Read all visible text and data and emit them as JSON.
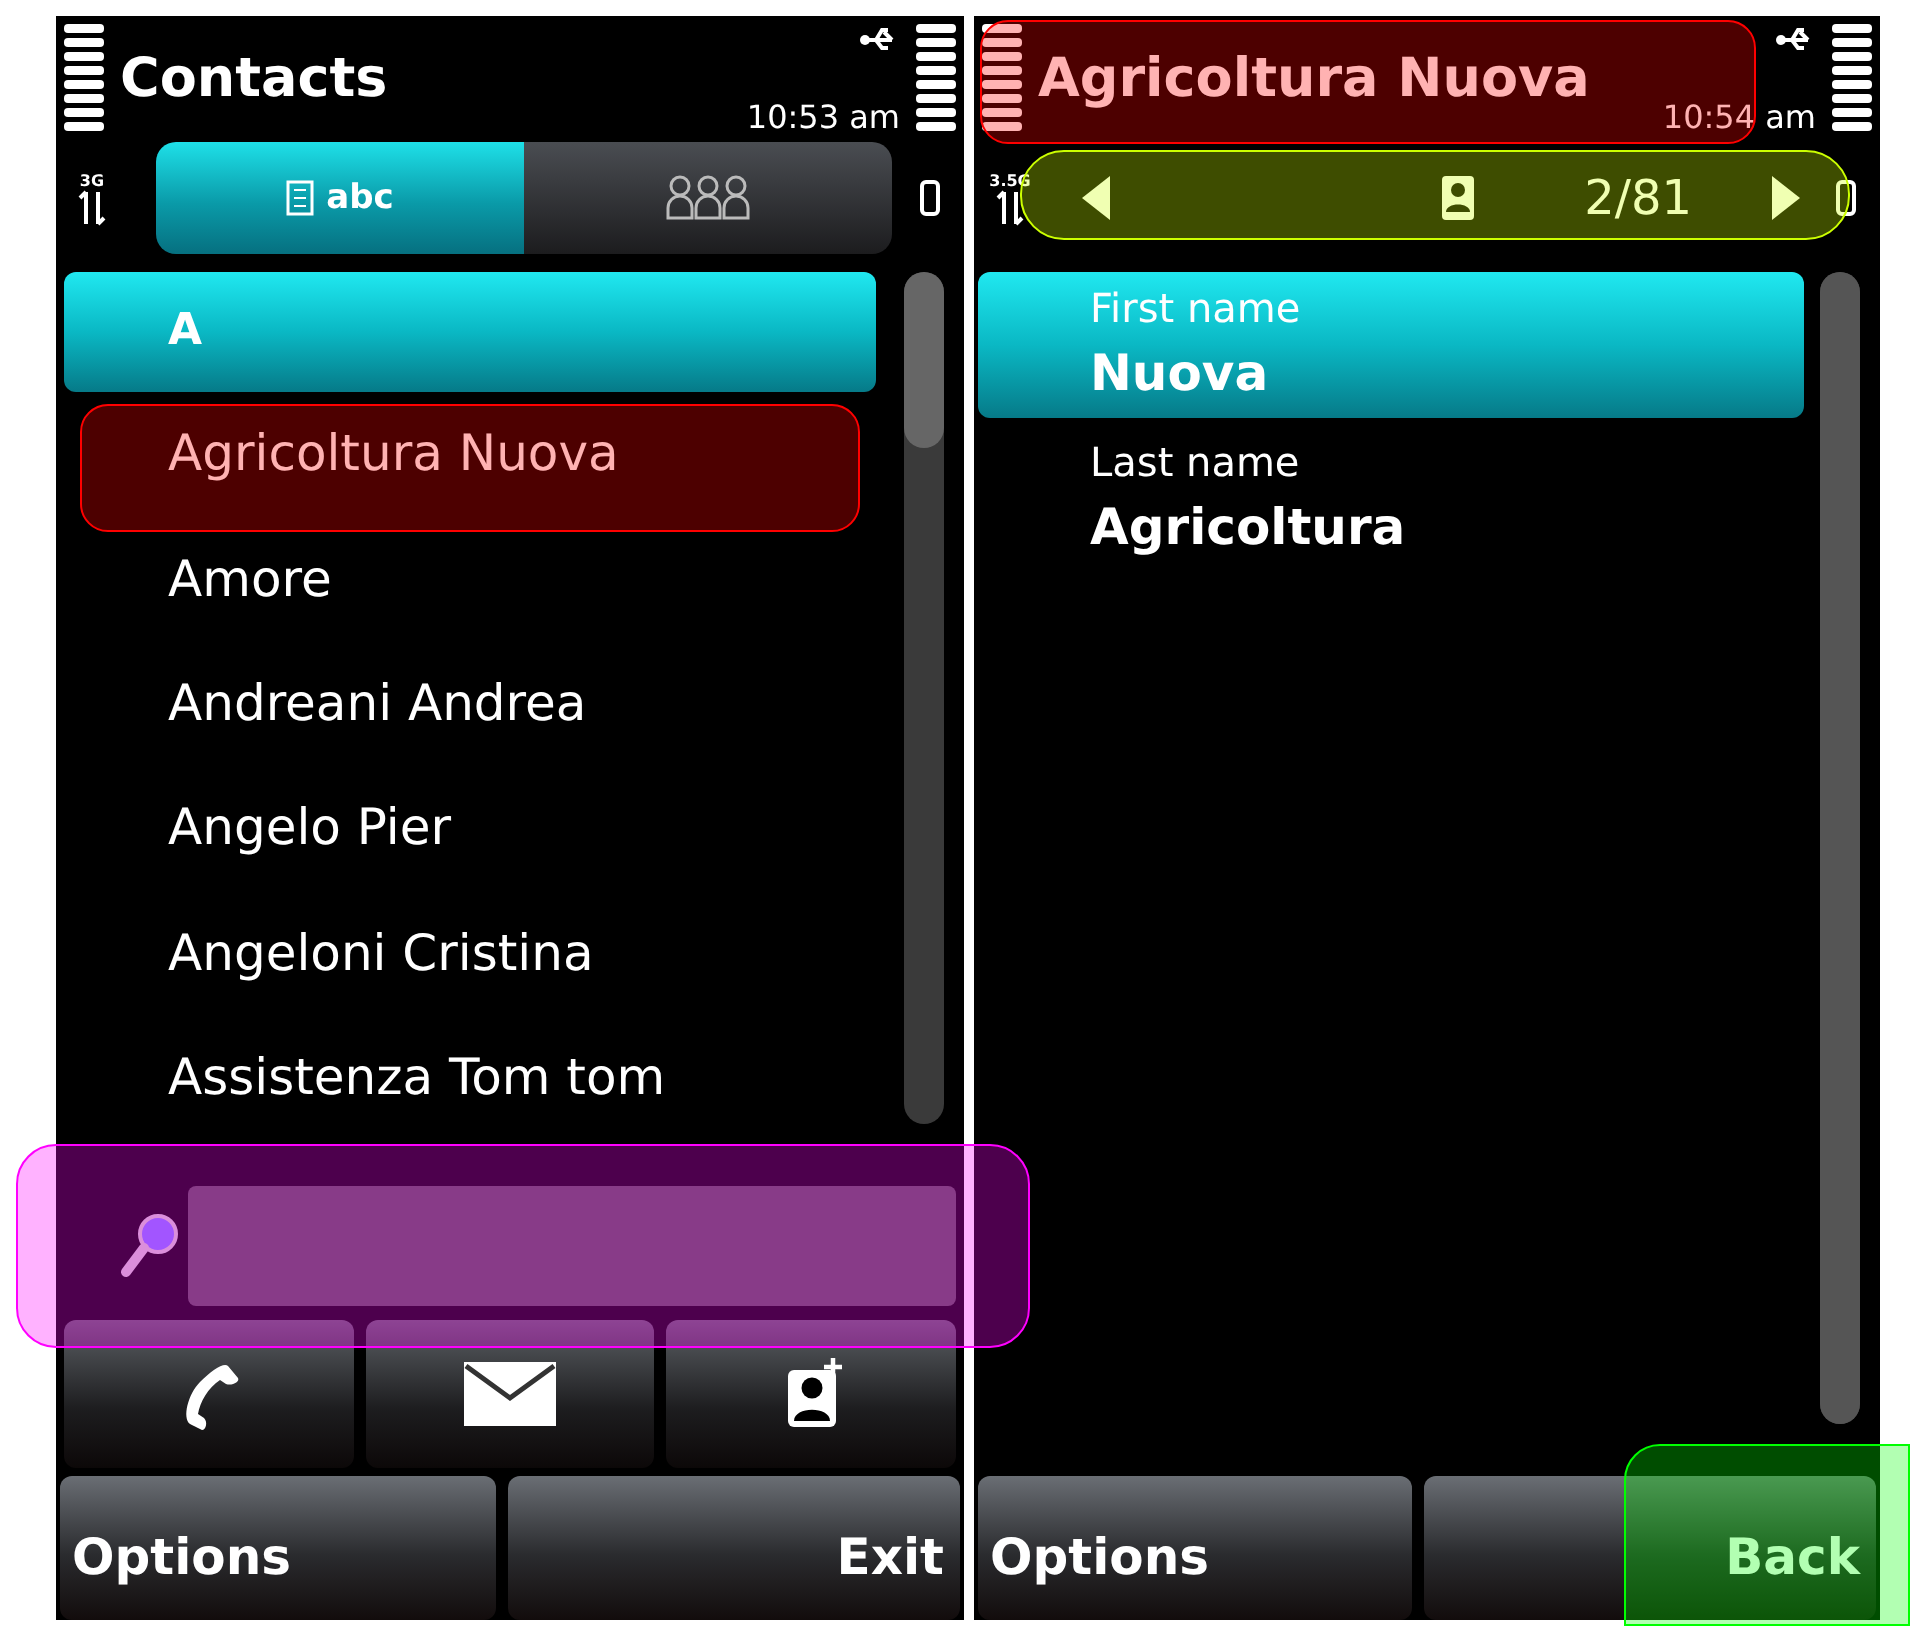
{
  "screens": [
    {
      "kind": "list",
      "title": "Contacts",
      "time": "10:53 am",
      "network": "3G",
      "tabs": [
        {
          "kind": "list",
          "label": "abc",
          "selected": true
        },
        {
          "kind": "groups",
          "selected": false
        }
      ],
      "section": "A",
      "contacts": [
        {
          "name": "Agricoltura Nuova"
        },
        {
          "name": "Amore"
        },
        {
          "name": "Andreani Andrea"
        },
        {
          "name": "Angelo Pier"
        },
        {
          "name": "Angeloni Cristina"
        },
        {
          "name": "Assistenza Tom tom"
        }
      ],
      "actions": [
        {
          "kind": "call"
        },
        {
          "kind": "message"
        },
        {
          "kind": "add_contact"
        }
      ],
      "softkeys": [
        {
          "label": "Options"
        },
        {
          "label": "Exit"
        }
      ]
    },
    {
      "kind": "detail",
      "title": "Agricoltura Nuova",
      "time": "10:54 am",
      "network": "3.5G",
      "counter": "2/81",
      "fields": [
        {
          "label": "First name",
          "value": "Nuova",
          "selected": true
        },
        {
          "label": "Last name",
          "value": "Agricoltura",
          "selected": false
        }
      ],
      "softkeys": [
        {
          "label": "Options"
        },
        {
          "label": "Back"
        }
      ]
    }
  ],
  "highlights": [
    {
      "kind": "contact_row",
      "color": "#ff0000"
    },
    {
      "kind": "title",
      "color": "#ff0000"
    },
    {
      "kind": "nav",
      "color": "#ccff00"
    },
    {
      "kind": "search",
      "color": "#ff00ff"
    },
    {
      "kind": "back_key",
      "color": "#00ff00"
    }
  ]
}
